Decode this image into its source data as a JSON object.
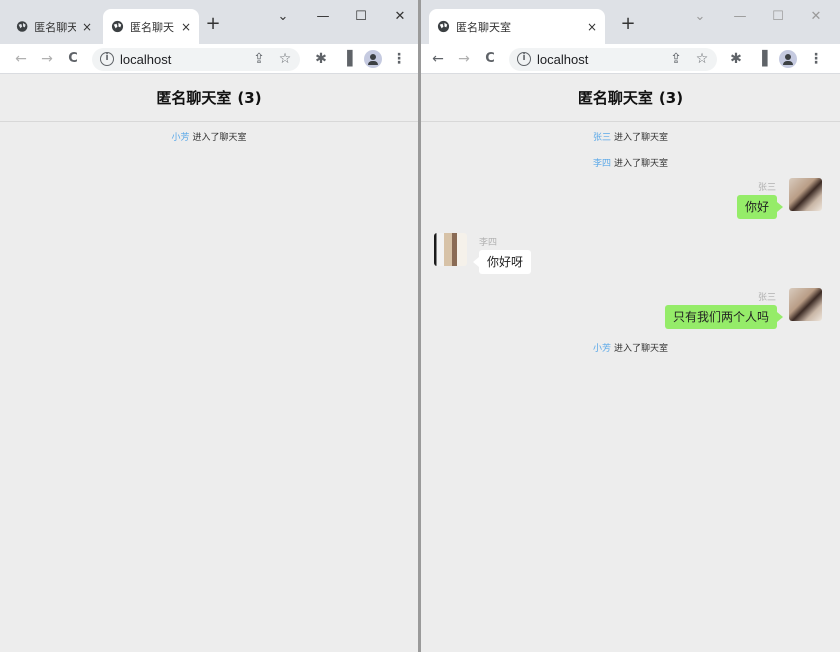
{
  "left_window": {
    "tabs": [
      {
        "title": "匿名聊天",
        "close": "×"
      },
      {
        "title": "匿名聊天",
        "close": "×"
      }
    ],
    "new_tab": "+",
    "controls": {
      "dropdown": "⌄",
      "minimize": "—",
      "maximize": "☐",
      "close": "✕"
    },
    "toolbar": {
      "back": "←",
      "forward": "→",
      "reload": "C",
      "info": "i",
      "url": "localhost",
      "share": "⇪",
      "star": "☆",
      "extensions": "✱",
      "sidepanel": "▐",
      "menu": "⋮"
    },
    "chat": {
      "title": "匿名聊天室",
      "count": "(3)",
      "notices": [
        {
          "name": "小芳",
          "text": "进入了聊天室"
        }
      ]
    }
  },
  "right_window": {
    "tabs": [
      {
        "title": "匿名聊天室",
        "close": "×"
      }
    ],
    "new_tab": "+",
    "controls": {
      "dropdown": "⌄",
      "minimize": "—",
      "maximize": "☐",
      "close": "✕"
    },
    "toolbar": {
      "back": "←",
      "forward": "→",
      "reload": "C",
      "info": "i",
      "url": "localhost",
      "share": "⇪",
      "star": "☆",
      "extensions": "✱",
      "sidepanel": "▐",
      "menu": "⋮"
    },
    "chat": {
      "title": "匿名聊天室",
      "count": "(3)",
      "items": [
        {
          "kind": "notice",
          "name": "张三",
          "text": "进入了聊天室"
        },
        {
          "kind": "notice",
          "name": "李四",
          "text": "进入了聊天室"
        },
        {
          "kind": "message",
          "side": "right",
          "sender": "张三",
          "text": "你好"
        },
        {
          "kind": "message",
          "side": "left",
          "sender": "李四",
          "text": "你好呀"
        },
        {
          "kind": "message",
          "side": "right",
          "sender": "张三",
          "text": "只有我们两个人吗"
        },
        {
          "kind": "notice",
          "name": "小芳",
          "text": "进入了聊天室"
        }
      ]
    }
  },
  "colors": {
    "self_bubble": "#95ec69",
    "other_bubble": "#ffffff",
    "username": "#5aa8e8",
    "background": "#ededed"
  }
}
